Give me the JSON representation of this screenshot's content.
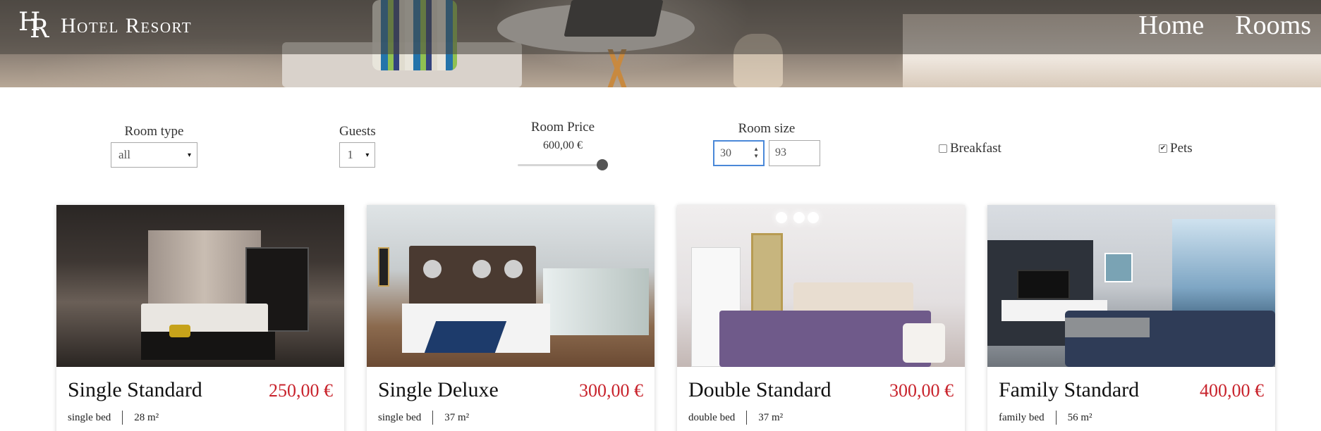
{
  "navbar": {
    "logo_mark_h": "H",
    "logo_mark_r": "R",
    "brand": "Hotel Resort",
    "links": [
      "Home",
      "Rooms"
    ]
  },
  "filters": {
    "room_type": {
      "label": "Room type",
      "value": "all"
    },
    "guests": {
      "label": "Guests",
      "value": "1"
    },
    "room_price": {
      "label": "Room Price",
      "value": "600,00 €",
      "slider_fraction": 1.0
    },
    "room_size": {
      "label": "Room size",
      "min": "30",
      "max": "93"
    },
    "breakfast": {
      "label": "Breakfast",
      "checked": false
    },
    "pets": {
      "label": "Pets",
      "checked": true,
      "checkmark": "✔"
    }
  },
  "rooms": [
    {
      "name": "Single Standard",
      "price": "250,00 €",
      "bed": "single bed",
      "size": "28 m²"
    },
    {
      "name": "Single Deluxe",
      "price": "300,00 €",
      "bed": "single bed",
      "size": "37 m²"
    },
    {
      "name": "Double Standard",
      "price": "300,00 €",
      "bed": "double bed",
      "size": "37 m²"
    },
    {
      "name": "Family Standard",
      "price": "400,00 €",
      "bed": "family bed",
      "size": "56 m²"
    }
  ],
  "colors": {
    "price": "#c8232c",
    "focus": "#4a88d8"
  },
  "icons": {
    "select_caret": "▾",
    "spinner": "▲▼"
  }
}
